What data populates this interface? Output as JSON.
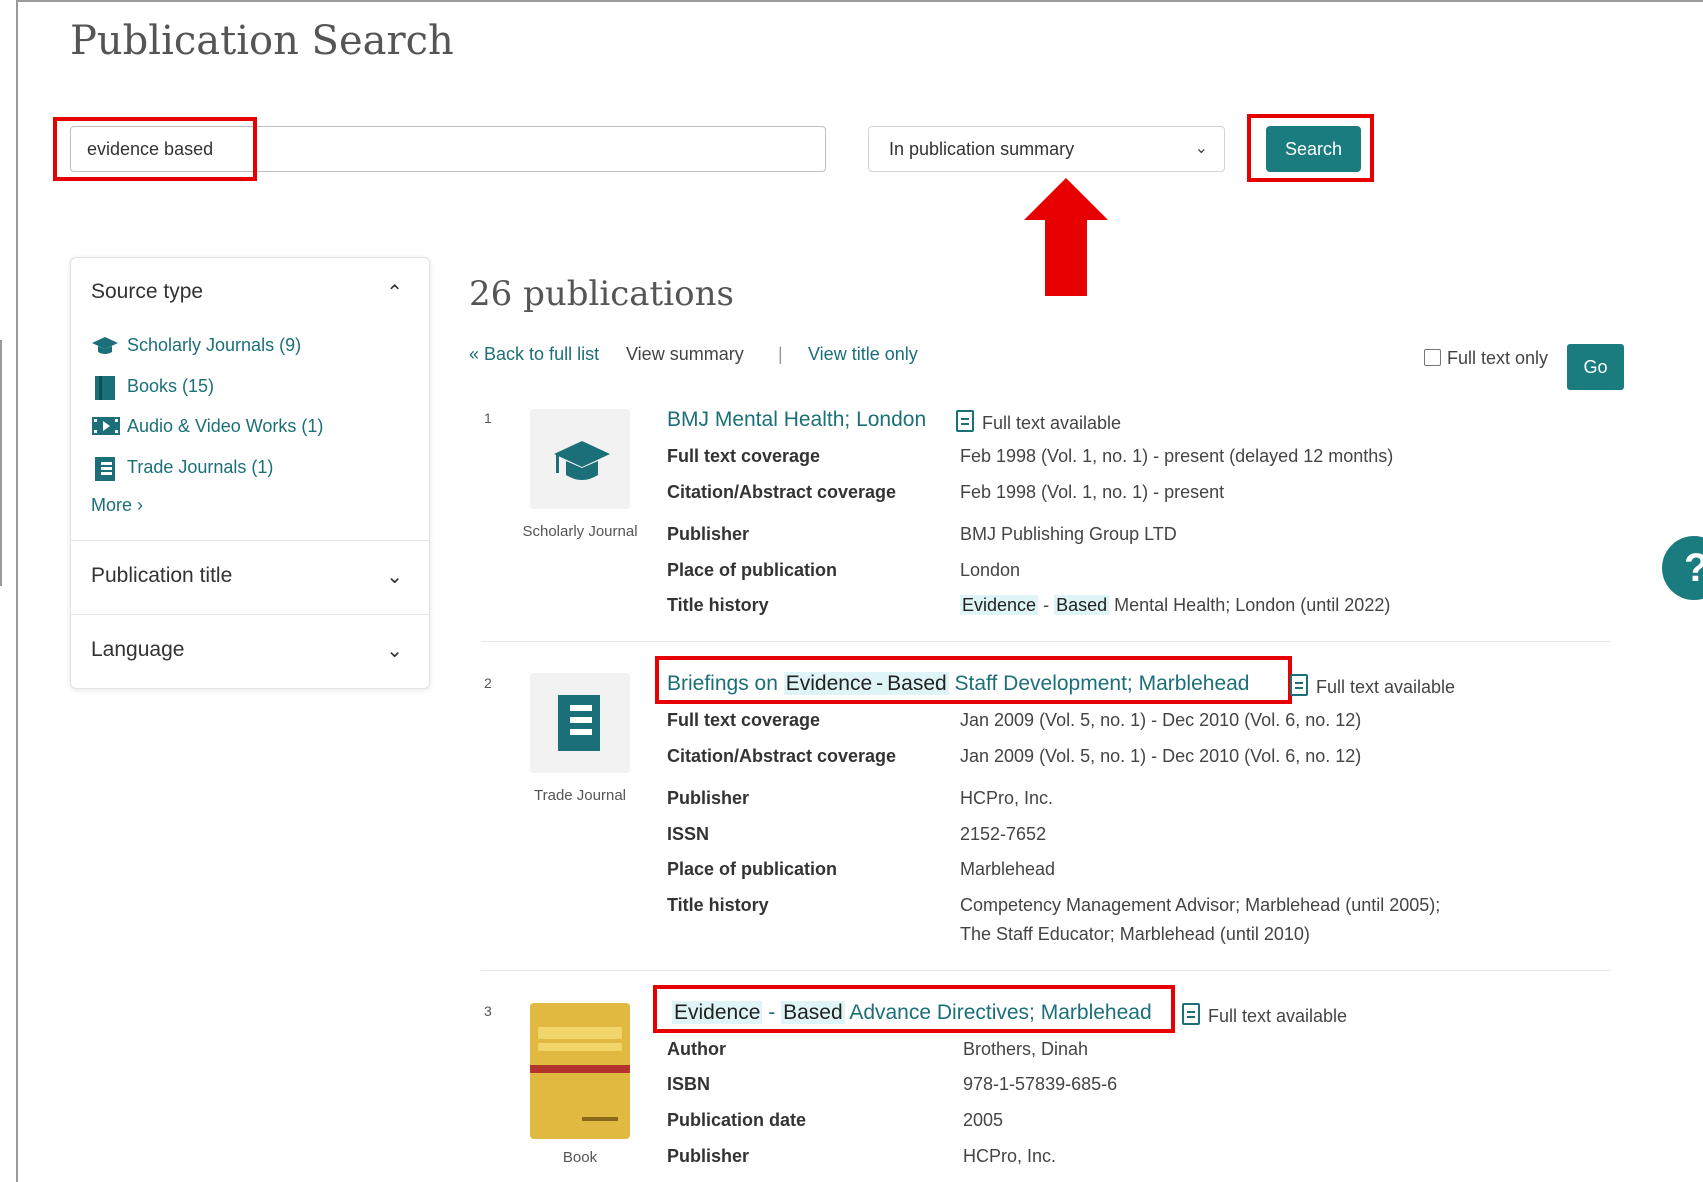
{
  "page_title": "Publication Search",
  "search": {
    "query": "evidence based",
    "scope": "In publication summary",
    "button": "Search"
  },
  "sidebar": {
    "source_type": {
      "heading": "Source type",
      "items": [
        {
          "label": "Scholarly Journals (9)",
          "icon": "graduation-cap-icon"
        },
        {
          "label": "Books (15)",
          "icon": "book-icon"
        },
        {
          "label": "Audio & Video Works (1)",
          "icon": "film-icon"
        },
        {
          "label": "Trade Journals (1)",
          "icon": "trade-journal-icon"
        }
      ],
      "more": "More ›"
    },
    "publication_title": "Publication title",
    "language": "Language"
  },
  "results": {
    "count": "26 publications",
    "back": "Back to full list",
    "view_summary": "View summary",
    "divider": "|",
    "view_title_only": "View title only",
    "full_text_only": "Full text only",
    "go": "Go",
    "items": [
      {
        "num": "1",
        "type": "Scholarly Journal",
        "title": "BMJ Mental Health; London",
        "full_text": "Full text available",
        "fields": [
          {
            "label": "Full text coverage",
            "value": "Feb 1998 (Vol. 1, no. 1) - present (delayed 12 months)"
          },
          {
            "label": "Citation/Abstract coverage",
            "value": "Feb 1998 (Vol. 1, no. 1) - present"
          },
          {
            "label": "Publisher",
            "value": "BMJ Publishing Group LTD"
          },
          {
            "label": "Place of publication",
            "value": "London"
          },
          {
            "label": "Title history",
            "value_hl1": "Evidence",
            "value_dash": "-",
            "value_hl2": "Based",
            "value_rest": "Mental Health; London (until 2022)"
          }
        ]
      },
      {
        "num": "2",
        "type": "Trade Journal",
        "title_pre": "Briefings on",
        "title_hl1": "Evidence",
        "title_dash": "-",
        "title_hl2": "Based",
        "title_post": "Staff Development; Marblehead",
        "full_text": "Full text available",
        "fields": [
          {
            "label": "Full text coverage",
            "value": "Jan 2009 (Vol. 5, no. 1) - Dec 2010 (Vol. 6, no. 12)"
          },
          {
            "label": "Citation/Abstract coverage",
            "value": "Jan 2009 (Vol. 5, no. 1) - Dec 2010 (Vol. 6, no. 12)"
          },
          {
            "label": "Publisher",
            "value": "HCPro, Inc."
          },
          {
            "label": "ISSN",
            "value": "2152-7652"
          },
          {
            "label": "Place of publication",
            "value": "Marblehead"
          },
          {
            "label": "Title history",
            "value": "Competency Management Advisor; Marblehead (until 2005);",
            "value2": "The Staff Educator; Marblehead (until 2010)"
          }
        ]
      },
      {
        "num": "3",
        "type": "Book",
        "title_hl1": "Evidence",
        "title_dash": "-",
        "title_hl2": "Based",
        "title_post": "Advance Directives; Marblehead",
        "full_text": "Full text available",
        "fields": [
          {
            "label": "Author",
            "value": "Brothers, Dinah"
          },
          {
            "label": "ISBN",
            "value": "978-1-57839-685-6"
          },
          {
            "label": "Publication date",
            "value": "2005"
          },
          {
            "label": "Publisher",
            "value": "HCPro, Inc."
          }
        ]
      }
    ]
  },
  "colors": {
    "accent": "#1b7c80",
    "link": "#1b6f78",
    "highlight": "#dff4f6",
    "annotation": "#e60000"
  }
}
